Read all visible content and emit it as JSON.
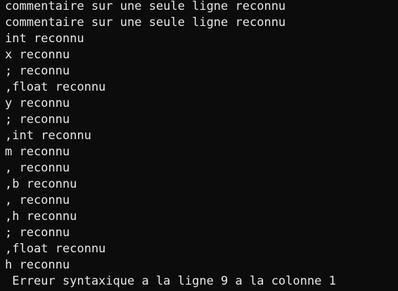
{
  "terminal": {
    "lines": [
      "commentaire sur une seule ligne reconnu",
      "commentaire sur une seule ligne reconnu",
      "int reconnu",
      "x reconnu",
      "; reconnu",
      ",float reconnu",
      "y reconnu",
      "; reconnu",
      ",int reconnu",
      "m reconnu",
      ", reconnu",
      ",b reconnu",
      ", reconnu",
      ",h reconnu",
      "; reconnu",
      ",float reconnu",
      "h reconnu",
      " Erreur syntaxique a la ligne 9 a la colonne 1"
    ]
  },
  "colors": {
    "background": "#0c0c0c",
    "text": "#e6e6e6"
  }
}
